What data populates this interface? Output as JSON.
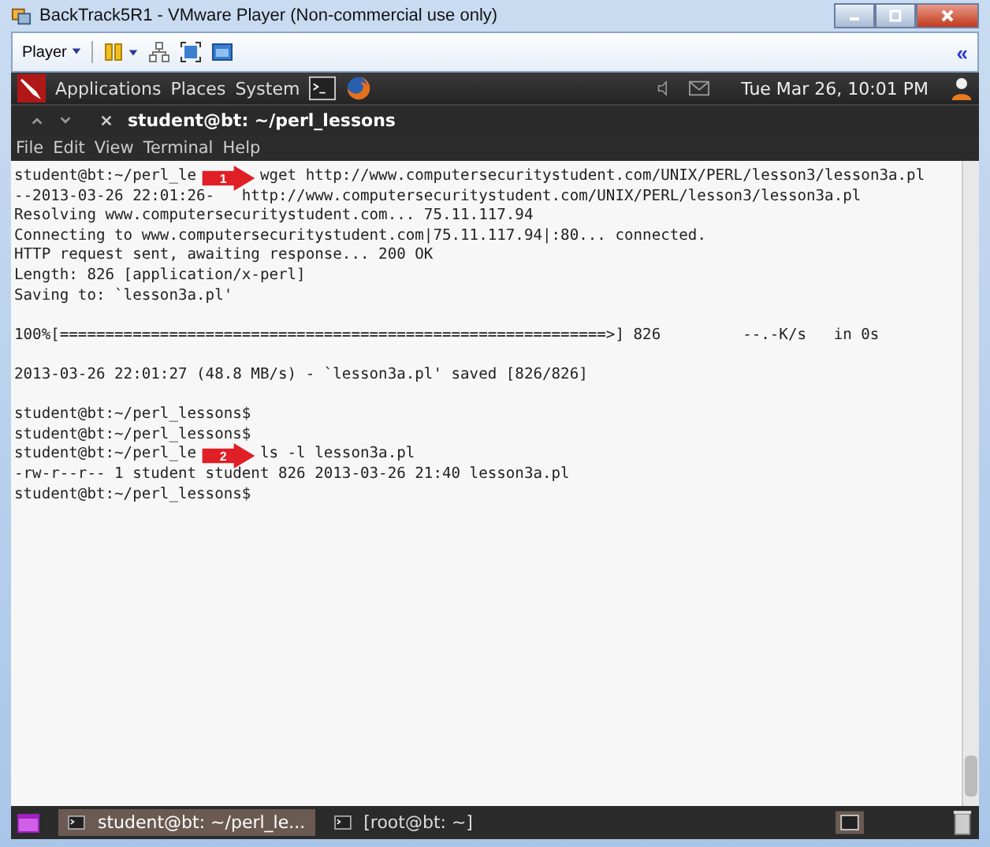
{
  "window": {
    "title": "BackTrack5R1 - VMware Player (Non-commercial use only)"
  },
  "toolbar": {
    "player_menu": "Player",
    "collapse": "«"
  },
  "panel": {
    "menus": [
      "Applications",
      "Places",
      "System"
    ],
    "clock": "Tue Mar 26, 10:01 PM"
  },
  "terminal": {
    "title": "student@bt: ~/perl_lessons",
    "menu": [
      "File",
      "Edit",
      "View",
      "Terminal",
      "Help"
    ],
    "lines": [
      {
        "kind": "split",
        "text": "student@bt:~/perl_le",
        "after": "wget http://www.computersecuritystudent.com/UNIX/PERL/lesson3/lesson3a.pl"
      },
      {
        "kind": "split",
        "text": "--2013-03-26 22:01:26-",
        "after": "http://www.computersecuritystudent.com/UNIX/PERL/lesson3/lesson3a.pl"
      },
      {
        "kind": "plain",
        "text": "Resolving www.computersecuritystudent.com... 75.11.117.94"
      },
      {
        "kind": "plain",
        "text": "Connecting to www.computersecuritystudent.com|75.11.117.94|:80... connected."
      },
      {
        "kind": "plain",
        "text": "HTTP request sent, awaiting response... 200 OK"
      },
      {
        "kind": "plain",
        "text": "Length: 826 [application/x-perl]"
      },
      {
        "kind": "plain",
        "text": "Saving to: `lesson3a.pl'"
      },
      {
        "kind": "blank"
      },
      {
        "kind": "plain",
        "text": "100%[============================================================>] 826         --.-K/s   in 0s"
      },
      {
        "kind": "blank"
      },
      {
        "kind": "plain",
        "text": "2013-03-26 22:01:27 (48.8 MB/s) - `lesson3a.pl' saved [826/826]"
      },
      {
        "kind": "blank"
      },
      {
        "kind": "plain",
        "text": "student@bt:~/perl_lessons$"
      },
      {
        "kind": "plain",
        "text": "student@bt:~/perl_lessons$"
      },
      {
        "kind": "split",
        "text": "student@bt:~/perl_le",
        "after": "ls -l lesson3a.pl"
      },
      {
        "kind": "plain",
        "text": "-rw-r--r-- 1 student student 826 2013-03-26 21:40 lesson3a.pl"
      },
      {
        "kind": "plain",
        "text": "student@bt:~/perl_lessons$"
      }
    ],
    "callouts": [
      {
        "label": "1"
      },
      {
        "label": "2"
      }
    ]
  },
  "taskbar": {
    "items": [
      {
        "label": "student@bt: ~/perl_le...",
        "selected": true
      },
      {
        "label": "[root@bt: ~]",
        "selected": false
      }
    ]
  }
}
